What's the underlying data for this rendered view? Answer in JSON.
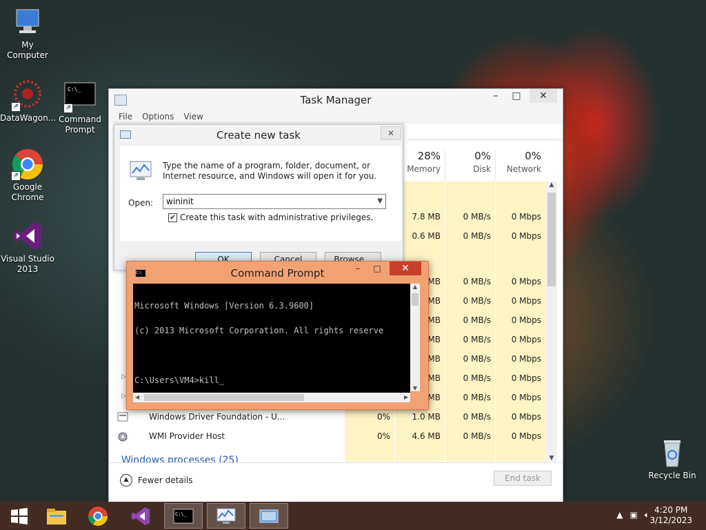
{
  "desktop": {
    "icons": [
      {
        "label": "My Computer"
      },
      {
        "label": "DataWagon..."
      },
      {
        "label": "Command Prompt"
      },
      {
        "label": "Google Chrome"
      },
      {
        "label": "Visual Studio 2013"
      },
      {
        "label": "Recycle Bin"
      }
    ]
  },
  "task_manager": {
    "title": "Task Manager",
    "menu": [
      "File",
      "Options",
      "View"
    ],
    "columns": [
      {
        "pct": "28%",
        "label": "Memory"
      },
      {
        "pct": "0%",
        "label": "Disk"
      },
      {
        "pct": "0%",
        "label": "Network"
      }
    ],
    "rows": [
      {
        "cpu": "",
        "memory": "7.8 MB",
        "disk": "0 MB/s",
        "network": "0 Mbps"
      },
      {
        "cpu": "",
        "memory": "0.6 MB",
        "disk": "0 MB/s",
        "network": "0 Mbps"
      },
      {
        "cpu": "",
        "memory": "MB",
        "disk": "0 MB/s",
        "network": "0 Mbps"
      },
      {
        "cpu": "",
        "memory": "MB",
        "disk": "0 MB/s",
        "network": "0 Mbps"
      },
      {
        "cpu": "",
        "memory": "MB",
        "disk": "0 MB/s",
        "network": "0 Mbps"
      },
      {
        "cpu": "",
        "memory": "MB",
        "disk": "0 MB/s",
        "network": "0 Mbps"
      },
      {
        "cpu": "",
        "memory": "MB",
        "disk": "0 MB/s",
        "network": "0 Mbps"
      },
      {
        "cpu": "",
        "memory": "MB",
        "disk": "0 MB/s",
        "network": "0 Mbps"
      },
      {
        "cpu": "",
        "memory": "MB",
        "disk": "0 MB/s",
        "network": "0 Mbps"
      },
      {
        "name": "Windows Driver Foundation - U...",
        "cpu": "0%",
        "memory": "1.0 MB",
        "disk": "0 MB/s",
        "network": "0 Mbps"
      },
      {
        "name": "WMI Provider Host",
        "cpu": "0%",
        "memory": "4.6 MB",
        "disk": "0 MB/s",
        "network": "0 Mbps"
      }
    ],
    "group_header": "Windows processes (25)",
    "fewer_details": "Fewer details",
    "end_task": "End task"
  },
  "create_task": {
    "title": "Create new task",
    "message": "Type the name of a program, folder, document, or Internet resource, and Windows will open it for you.",
    "open_label": "Open:",
    "open_value": "wininit",
    "admin_checkbox": "Create this task with administrative privileges.",
    "ok": "OK",
    "cancel": "Cancel",
    "browse": "Browse..."
  },
  "command_prompt": {
    "title": "Command Prompt",
    "lines": [
      "Microsoft Windows [Version 6.3.9600]",
      "(c) 2013 Microsoft Corporation. All rights reserve",
      "",
      "C:\\Users\\VM4>kill_"
    ]
  },
  "taskbar": {
    "time": "4:20 PM",
    "date": "3/12/2023"
  }
}
